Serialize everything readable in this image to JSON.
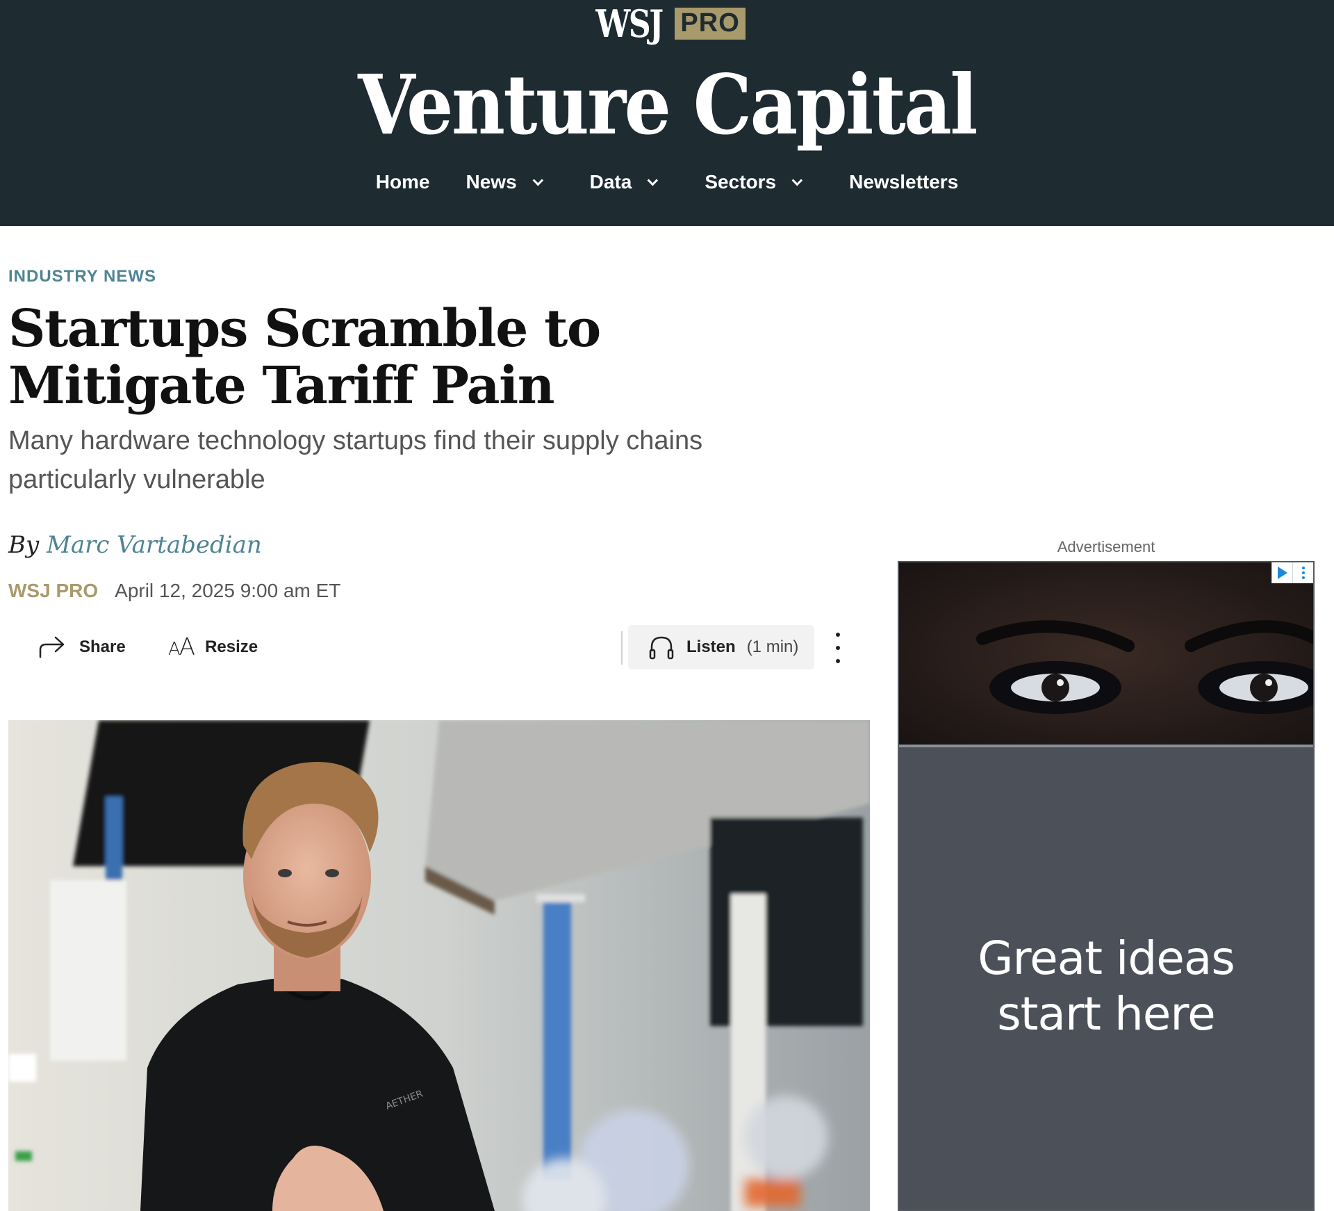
{
  "header": {
    "brand_wsj": "WSJ",
    "brand_pro": "PRO",
    "section_title": "Venture Capital",
    "nav": [
      {
        "label": "Home",
        "has_dropdown": false
      },
      {
        "label": "News",
        "has_dropdown": true
      },
      {
        "label": "Data",
        "has_dropdown": true
      },
      {
        "label": "Sectors",
        "has_dropdown": true
      },
      {
        "label": "Newsletters",
        "has_dropdown": false
      }
    ]
  },
  "article": {
    "kicker": "INDUSTRY NEWS",
    "headline": "Startups Scramble to Mitigate Tariff Pain",
    "dek": "Many hardware technology startups find their supply chains particularly vulnerable",
    "byline_prefix": "By",
    "author": "Marc Vartabedian",
    "publication": "WSJ PRO",
    "date": "April 12, 2025 9:00 am ET",
    "photo_shirt_text": "AETHER"
  },
  "toolbar": {
    "share_label": "Share",
    "resize_label": "Resize",
    "resize_glyph_large": "A",
    "resize_glyph_small": "A",
    "listen_label": "Listen",
    "listen_duration": "(1 min)"
  },
  "ad": {
    "label": "Advertisement",
    "line1": "Great ideas",
    "line2": "start here"
  },
  "colors": {
    "header_bg": "#1e2b31",
    "accent_teal": "#4e8493",
    "brand_gold": "#a99a6c",
    "ad_bg": "#4c5059"
  },
  "icons": {
    "share": "share-arrow-icon",
    "resize": "text-resize-icon",
    "listen": "headphones-icon",
    "more": "vertical-dots-icon",
    "dropdown": "chevron-down-icon",
    "ad_choices": "adchoices-icon"
  }
}
